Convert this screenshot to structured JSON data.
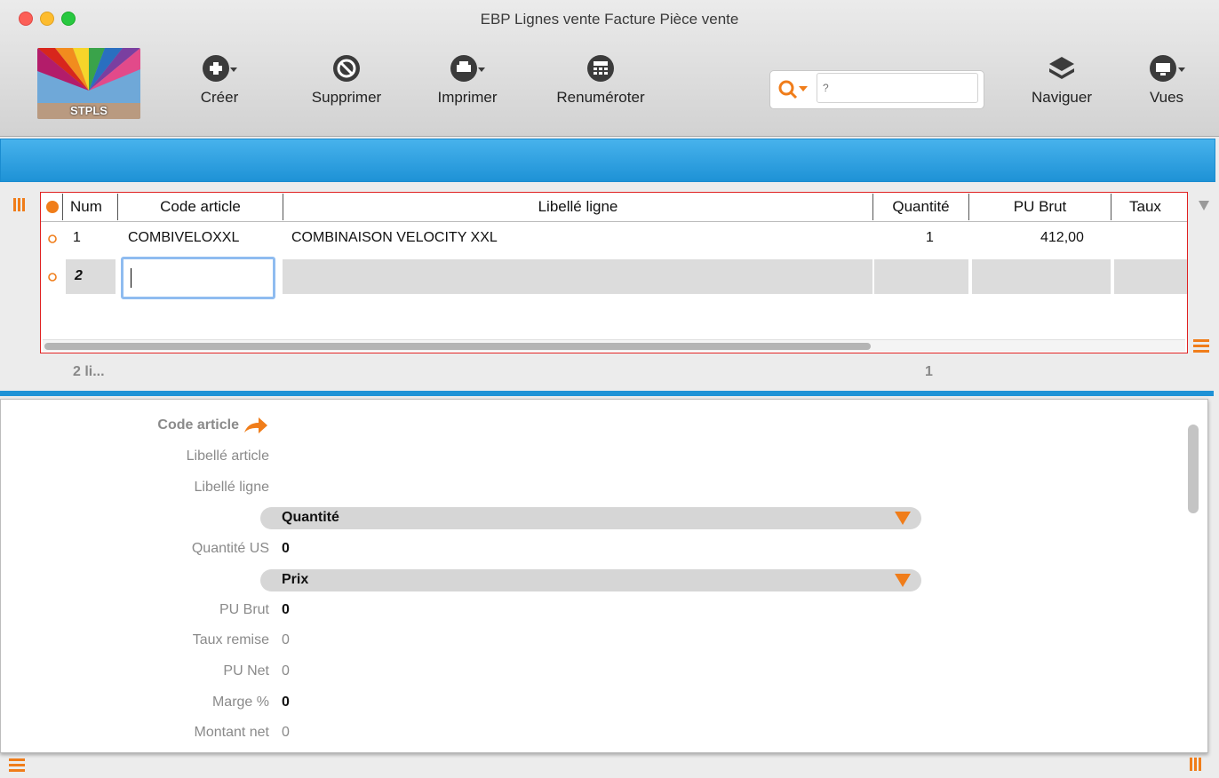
{
  "window": {
    "title": "EBP Lignes vente Facture Pièce vente"
  },
  "logo": {
    "text": "STPLS"
  },
  "toolbar": {
    "create_label": "Créer",
    "delete_label": "Supprimer",
    "print_label": "Imprimer",
    "renumber_label": "Renuméroter",
    "navigate_label": "Naviguer",
    "views_label": "Vues"
  },
  "search": {
    "placeholder": "?"
  },
  "grid": {
    "columns": [
      "Num",
      "Code article",
      "Libellé ligne",
      "Quantité",
      "PU Brut",
      "Taux"
    ],
    "rows": [
      {
        "num": "1",
        "code": "COMBIVELOXXL",
        "label": "COMBINAISON VELOCITY XXL",
        "qty": "1",
        "pu_brut": "412,00"
      },
      {
        "num": "2",
        "code": "",
        "label": "",
        "qty": "",
        "pu_brut": ""
      }
    ],
    "footer": {
      "count": "2 li...",
      "qty_total": "1"
    }
  },
  "detail": {
    "code_article_label": "Code article",
    "libelle_article_label": "Libellé article",
    "libelle_ligne_label": "Libellé ligne",
    "section_quantite": "Quantité",
    "quantite_us_label": "Quantité US",
    "quantite_us_value": "0",
    "section_prix": "Prix",
    "pu_brut_label": "PU Brut",
    "pu_brut_value": "0",
    "taux_remise_label": "Taux remise",
    "taux_remise_value": "0",
    "pu_net_label": "PU Net",
    "pu_net_value": "0",
    "marge_label": "Marge %",
    "marge_value": "0",
    "montant_net_label": "Montant net",
    "montant_net_value": "0"
  },
  "colors": {
    "accent": "#f07d1a",
    "band": "#1e92d6",
    "highlight": "#e02020"
  }
}
